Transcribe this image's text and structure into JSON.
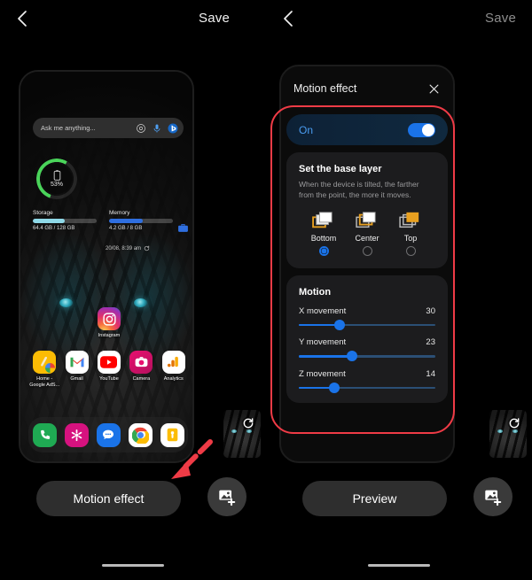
{
  "left_panel": {
    "topbar": {
      "back_icon": "chevron-left-icon",
      "save_label": "Save"
    },
    "home_screen": {
      "search": {
        "placeholder": "Ask me anything...",
        "icons": [
          "lens-icon",
          "mic-icon",
          "bing-icon"
        ]
      },
      "battery_widget": {
        "percent_label": "53%",
        "percent_value": 53,
        "icon": "battery-icon",
        "ring_color": "#4ad45a"
      },
      "storage": {
        "title": "Storage",
        "value": "64.4 GB / 128 GB",
        "fill_percent": 50,
        "bar_color": "#8fd9e8"
      },
      "memory": {
        "title": "Memory",
        "value": "4.2 GB / 8 GB",
        "fill_percent": 53,
        "bar_color": "#2f6fe0"
      },
      "clean_icon": "briefcase-icon",
      "timestamp": "20/08, 8:39 am",
      "refresh_icon": "refresh-icon",
      "featured_app": {
        "label": "Instagram",
        "icon": "instagram-icon"
      },
      "apps": [
        {
          "label": "Home - Google AdS...",
          "icon": "google-ads-icon"
        },
        {
          "label": "Gmail",
          "icon": "gmail-icon"
        },
        {
          "label": "YouTube",
          "icon": "youtube-icon"
        },
        {
          "label": "Camera",
          "icon": "camera-icon"
        },
        {
          "label": "Analytics",
          "icon": "analytics-icon"
        }
      ],
      "dock": [
        {
          "name": "phone-icon",
          "color": "#1faa53"
        },
        {
          "name": "contacts-icon",
          "color": "#d6127f"
        },
        {
          "name": "messages-icon",
          "color": "#1a73e8"
        },
        {
          "name": "chrome-icon",
          "color": "#ffffff"
        },
        {
          "name": "files-icon",
          "color": "#fbbc04"
        }
      ]
    },
    "thumbnail": {
      "name": "wallpaper-thumbnail",
      "refresh_icon": "refresh-icon"
    },
    "cta_label": "Motion effect",
    "add_button_icon": "add-image-icon",
    "annotation": {
      "arrow_color": "#ef3b46",
      "points_to": "Motion effect"
    }
  },
  "right_panel": {
    "topbar": {
      "back_icon": "chevron-left-icon",
      "save_label": "Save",
      "save_disabled": true
    },
    "sheet": {
      "title": "Motion effect",
      "close_icon": "close-icon",
      "toggle": {
        "label": "On",
        "state": true,
        "accent": "#1a73e8"
      },
      "base_layer": {
        "title": "Set the base layer",
        "description": "When the device is tilted, the farther from the point, the more it moves.",
        "options": [
          {
            "label": "Bottom",
            "selected": true,
            "icon": "layers-bottom-icon"
          },
          {
            "label": "Center",
            "selected": false,
            "icon": "layers-center-icon"
          },
          {
            "label": "Top",
            "selected": false,
            "icon": "layers-top-icon"
          }
        ]
      },
      "motion": {
        "title": "Motion",
        "sliders": [
          {
            "label": "X movement",
            "value": 30,
            "percent": 30
          },
          {
            "label": "Y movement",
            "value": 23,
            "percent": 39
          },
          {
            "label": "Z movement",
            "value": 14,
            "percent": 26
          }
        ]
      }
    },
    "thumbnail": {
      "name": "wallpaper-thumbnail",
      "refresh_icon": "refresh-icon"
    },
    "cta_label": "Preview",
    "add_button_icon": "add-image-icon",
    "annotation": {
      "highlight_color": "#ef3b46"
    }
  }
}
